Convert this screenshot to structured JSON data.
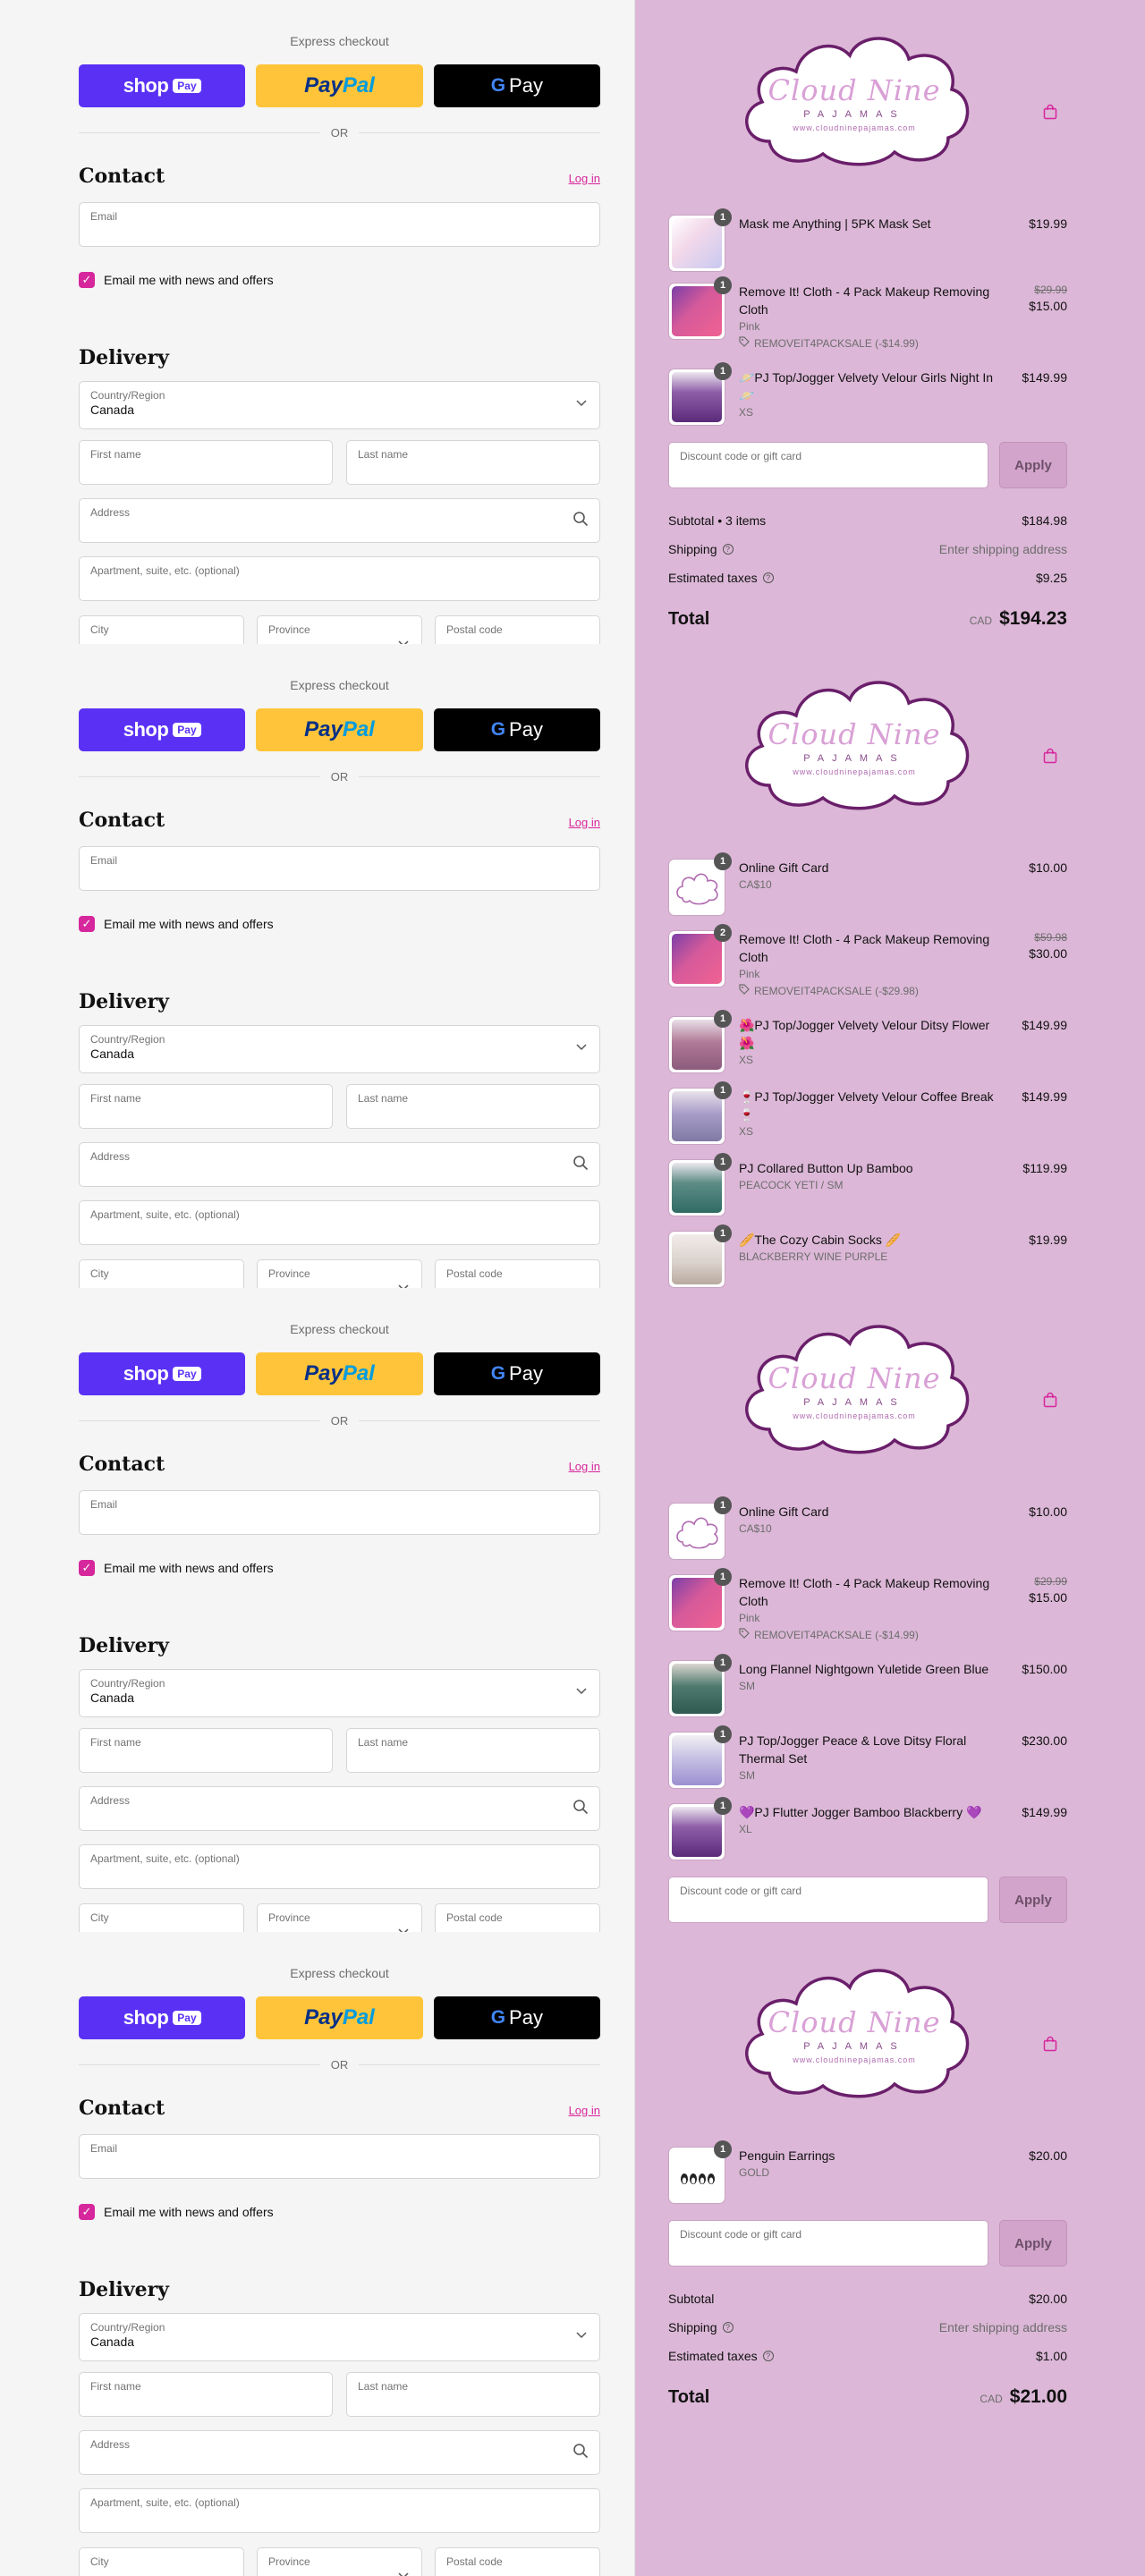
{
  "colors": {
    "accent": "#d6279c",
    "left_bg": "#f5f5f5",
    "right_bg": "#dcb7d7",
    "shop_pay": "#5a31f4",
    "paypal": "#ffc439",
    "gpay": "#000000"
  },
  "checkout": {
    "express_label": "Express checkout",
    "shop_word": "shop",
    "shop_badge": "Pay",
    "paypal_pay": "Pay",
    "paypal_pal": "Pal",
    "gpay_g": "G",
    "gpay_word": "Pay",
    "or_label": "OR",
    "contact_heading": "Contact",
    "login_link": "Log in",
    "email_label": "Email",
    "newsletter_label": "Email me with news and offers",
    "newsletter_checked": true,
    "delivery_heading": "Delivery",
    "country_label": "Country/Region",
    "country_value": "Canada",
    "first_name_label": "First name",
    "last_name_label": "Last name",
    "address_label": "Address",
    "apartment_label": "Apartment, suite, etc. (optional)",
    "city_label": "City",
    "province_label": "Province",
    "postal_label": "Postal code"
  },
  "logo": {
    "title": "Cloud Nine",
    "subtitle": "PAJAMAS",
    "url": "www.cloudninepajamas.com"
  },
  "icons": {
    "bag": "shopping-bag-icon",
    "search": "search-icon",
    "chevron": "chevron-down-icon",
    "tag": "tag-icon",
    "help": "question-circle-icon",
    "check": "checkmark-icon"
  },
  "panels": [
    {
      "items": [
        {
          "qty": "1",
          "name": "Mask me Anything | 5PK Mask Set",
          "variant": "",
          "discount": "",
          "old_price": "",
          "price": "$19.99",
          "thumb": "mask"
        },
        {
          "qty": "1",
          "name": "Remove It! Cloth - 4 Pack Makeup Removing Cloth",
          "variant": "Pink",
          "discount": "REMOVEIT4PACKSALE (-$14.99)",
          "old_price": "$29.99",
          "price": "$15.00",
          "thumb": "cloth"
        },
        {
          "qty": "1",
          "name": "🪐PJ Top/Jogger Velvety Velour Girls Night In 🪐",
          "variant": "XS",
          "discount": "",
          "old_price": "",
          "price": "$149.99",
          "thumb": "purple"
        }
      ],
      "discount_placeholder": "Discount code or gift card",
      "apply_label": "Apply",
      "summary": {
        "subtotal_label": "Subtotal • 3 items",
        "subtotal": "$184.98",
        "shipping_label": "Shipping",
        "shipping": "Enter shipping address",
        "taxes_label": "Estimated taxes",
        "taxes": "$9.25",
        "total_label": "Total",
        "currency": "CAD",
        "total": "$194.23"
      }
    },
    {
      "items": [
        {
          "qty": "1",
          "name": "Online Gift Card",
          "variant": "CA$10",
          "discount": "",
          "old_price": "",
          "price": "$10.00",
          "thumb": "gift"
        },
        {
          "qty": "2",
          "name": "Remove It! Cloth - 4 Pack Makeup Removing Cloth",
          "variant": "Pink",
          "discount": "REMOVEIT4PACKSALE (-$29.98)",
          "old_price": "$59.98",
          "price": "$30.00",
          "thumb": "cloth"
        },
        {
          "qty": "1",
          "name": "🌺PJ Top/Jogger Velvety Velour Ditsy Flower 🌺",
          "variant": "XS",
          "discount": "",
          "old_price": "",
          "price": "$149.99",
          "thumb": "floral"
        },
        {
          "qty": "1",
          "name": "🍷PJ Top/Jogger Velvety Velour Coffee Break 🍷",
          "variant": "XS",
          "discount": "",
          "old_price": "",
          "price": "$149.99",
          "thumb": "mauve"
        },
        {
          "qty": "1",
          "name": "PJ Collared Button Up Bamboo",
          "variant": "PEACOCK YETI / SM",
          "discount": "",
          "old_price": "",
          "price": "$119.99",
          "thumb": "teal"
        },
        {
          "qty": "1",
          "name": "🥖The Cozy Cabin Socks 🥖",
          "variant": "BLACKBERRY WINE PURPLE",
          "discount": "",
          "old_price": "",
          "price": "$19.99",
          "thumb": "socks"
        }
      ]
    },
    {
      "items": [
        {
          "qty": "1",
          "name": "Online Gift Card",
          "variant": "CA$10",
          "discount": "",
          "old_price": "",
          "price": "$10.00",
          "thumb": "gift"
        },
        {
          "qty": "1",
          "name": "Remove It! Cloth - 4 Pack Makeup Removing Cloth",
          "variant": "Pink",
          "discount": "REMOVEIT4PACKSALE (-$14.99)",
          "old_price": "$29.99",
          "price": "$15.00",
          "thumb": "cloth"
        },
        {
          "qty": "1",
          "name": "Long Flannel Nightgown Yuletide Green Blue",
          "variant": "SM",
          "discount": "",
          "old_price": "",
          "price": "$150.00",
          "thumb": "green"
        },
        {
          "qty": "1",
          "name": "PJ Top/Jogger Peace & Love Ditsy Floral Thermal Set",
          "variant": "SM",
          "discount": "",
          "old_price": "",
          "price": "$230.00",
          "thumb": "lilac"
        },
        {
          "qty": "1",
          "name": "💜PJ Flutter Jogger Bamboo Blackberry 💜",
          "variant": "XL",
          "discount": "",
          "old_price": "",
          "price": "$149.99",
          "thumb": "purple"
        }
      ],
      "discount_placeholder": "Discount code or gift card",
      "apply_label": "Apply"
    },
    {
      "items": [
        {
          "qty": "1",
          "name": "Penguin Earrings",
          "variant": "GOLD",
          "discount": "",
          "old_price": "",
          "price": "$20.00",
          "thumb": "earrings"
        }
      ],
      "discount_placeholder": "Discount code or gift card",
      "apply_label": "Apply",
      "summary": {
        "subtotal_label": "Subtotal",
        "subtotal": "$20.00",
        "shipping_label": "Shipping",
        "shipping": "Enter shipping address",
        "taxes_label": "Estimated taxes",
        "taxes": "$1.00",
        "total_label": "Total",
        "currency": "CAD",
        "total": "$21.00"
      }
    }
  ]
}
